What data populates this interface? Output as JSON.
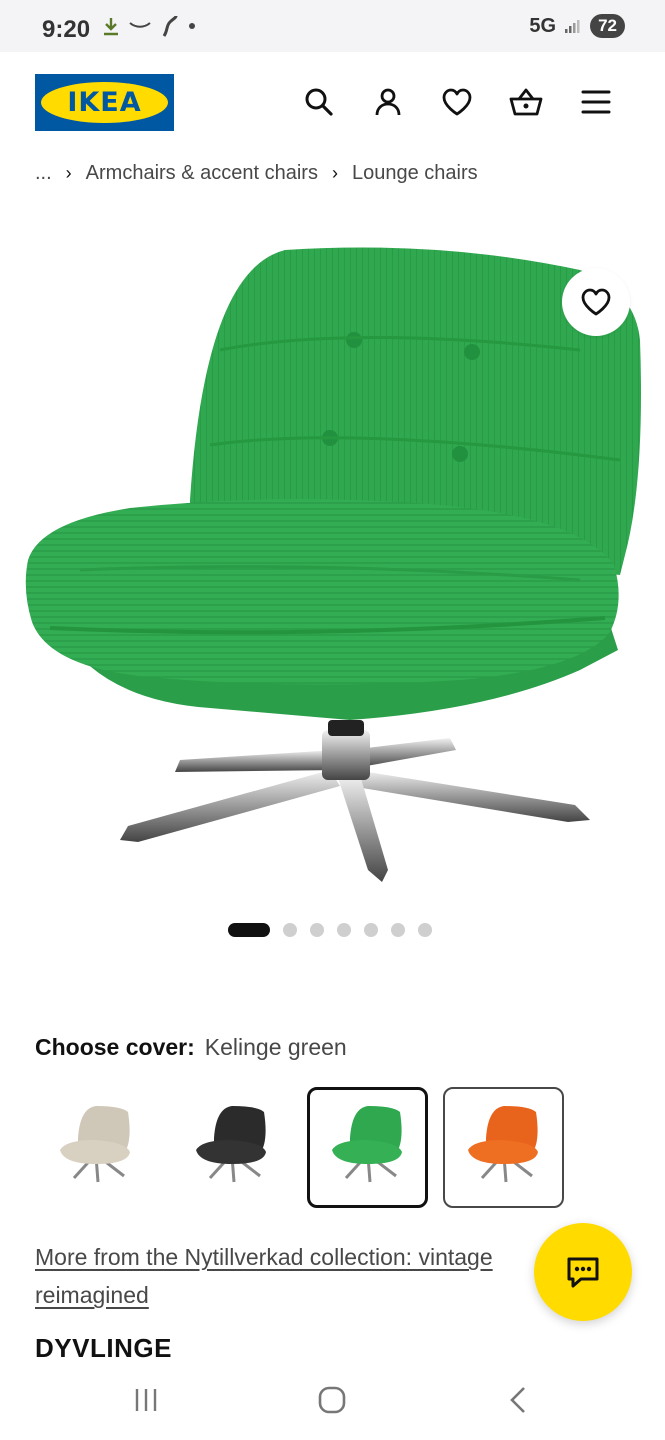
{
  "status_bar": {
    "time": "9:20",
    "network": "5G",
    "battery": "72"
  },
  "header": {
    "logo_text": "IKEA",
    "icons": [
      "search-icon",
      "account-icon",
      "favourites-icon",
      "basket-icon",
      "menu-icon"
    ]
  },
  "breadcrumb": {
    "ellipsis": "...",
    "items": [
      "Armchairs & accent chairs",
      "Lounge chairs"
    ]
  },
  "carousel": {
    "total_images": 7,
    "active_index": 0
  },
  "cover": {
    "label": "Choose cover:",
    "value": "Kelinge green",
    "options": [
      {
        "color": "#cfc7b8",
        "selected": false
      },
      {
        "color": "#2b2b2b",
        "selected": false
      },
      {
        "color": "#2fa84f",
        "selected": true
      },
      {
        "color": "#e8641c",
        "selected": false
      }
    ]
  },
  "collection_link": "More from the Nytillverkad collection: vintage reimagined",
  "product_name": "DYVLINGE",
  "colors": {
    "ikea_blue": "#0058a3",
    "ikea_yellow": "#ffdb00",
    "chair_green": "#2fa84f"
  }
}
